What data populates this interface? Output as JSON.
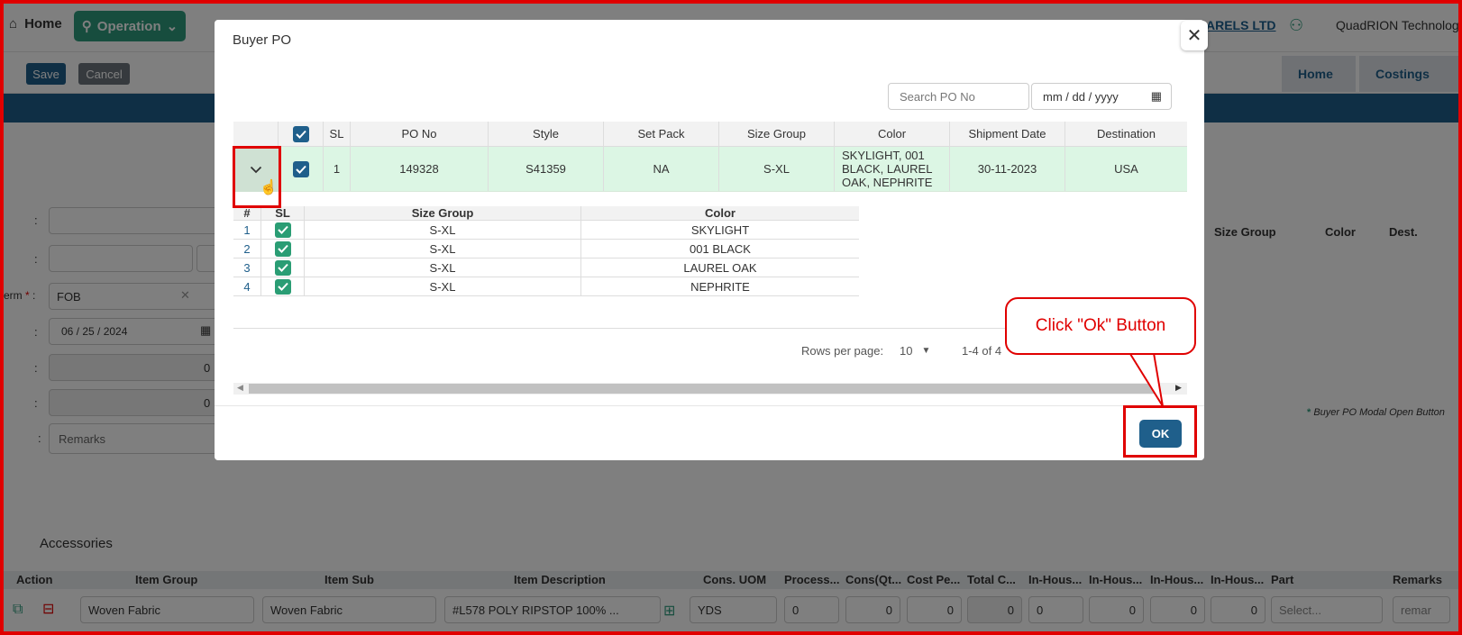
{
  "nav": {
    "home": "Home",
    "operation": "Operation",
    "company": "ARELS LTD",
    "user": "QuadRION Technolog"
  },
  "toolbar": {
    "save": "Save",
    "cancel": "Cancel",
    "crumbs": [
      "Home",
      "Costings"
    ]
  },
  "form": {
    "term_label": "erm",
    "term_value": "FOB",
    "date_value": "06 / 25 / 2024",
    "zero1": "0",
    "zero2": "0",
    "remarks_placeholder": "Remarks"
  },
  "right_panel": {
    "headers": [
      "Size Group",
      "Color",
      "Dest."
    ],
    "note": "Buyer PO Modal Open Button"
  },
  "accessories_tab": "Accessories",
  "grid": {
    "headers": [
      "Action",
      "Item Group",
      "Item Sub",
      "Item Description",
      "Cons. UOM",
      "Process...",
      "Cons(Qt...",
      "Cost Pe...",
      "Total C...",
      "In-Hous...",
      "In-Hous...",
      "In-Hous...",
      "In-Hous...",
      "Part",
      "Remarks"
    ],
    "row": {
      "item_group": "Woven Fabric",
      "item_sub": "Woven Fabric",
      "item_desc": "#L578 POLY RIPSTOP 100% ...",
      "uom": "YDS",
      "process": "0",
      "cons": "0",
      "cost": "0",
      "total": "0",
      "inh1": "0",
      "inh2": "0",
      "inh3": "0",
      "inh4": "0",
      "part": "Select...",
      "remarks": "remar"
    }
  },
  "modal": {
    "title": "Buyer PO",
    "search_placeholder": "Search PO No",
    "date_placeholder": "mm / dd / yyyy",
    "headers": {
      "sl": "SL",
      "po_no": "PO No",
      "style": "Style",
      "set_pack": "Set Pack",
      "size_group": "Size Group",
      "color": "Color",
      "shipment_date": "Shipment Date",
      "destination": "Destination"
    },
    "row": {
      "sl": "1",
      "po_no": "149328",
      "style": "S41359",
      "set_pack": "NA",
      "size_group": "S-XL",
      "color": "SKYLIGHT, 001 BLACK, LAUREL OAK, NEPHRITE",
      "shipment_date": "30-11-2023",
      "destination": "USA"
    },
    "sub_headers": {
      "num": "#",
      "sl": "SL",
      "size_group": "Size Group",
      "color": "Color"
    },
    "sub_rows": [
      {
        "num": "1",
        "size_group": "S-XL",
        "color": "SKYLIGHT"
      },
      {
        "num": "2",
        "size_group": "S-XL",
        "color": "001 BLACK"
      },
      {
        "num": "3",
        "size_group": "S-XL",
        "color": "LAUREL OAK"
      },
      {
        "num": "4",
        "size_group": "S-XL",
        "color": "NEPHRITE"
      }
    ],
    "pager": {
      "rows_label": "Rows per page:",
      "rows_value": "10",
      "range": "1-4 of 4"
    },
    "ok": "OK"
  },
  "annotation": {
    "callout": "Click \"Ok\" Button"
  },
  "colors": {
    "primary": "#1f5f8b",
    "accent_green": "#2f9b7d",
    "annotation_red": "#e00000"
  }
}
